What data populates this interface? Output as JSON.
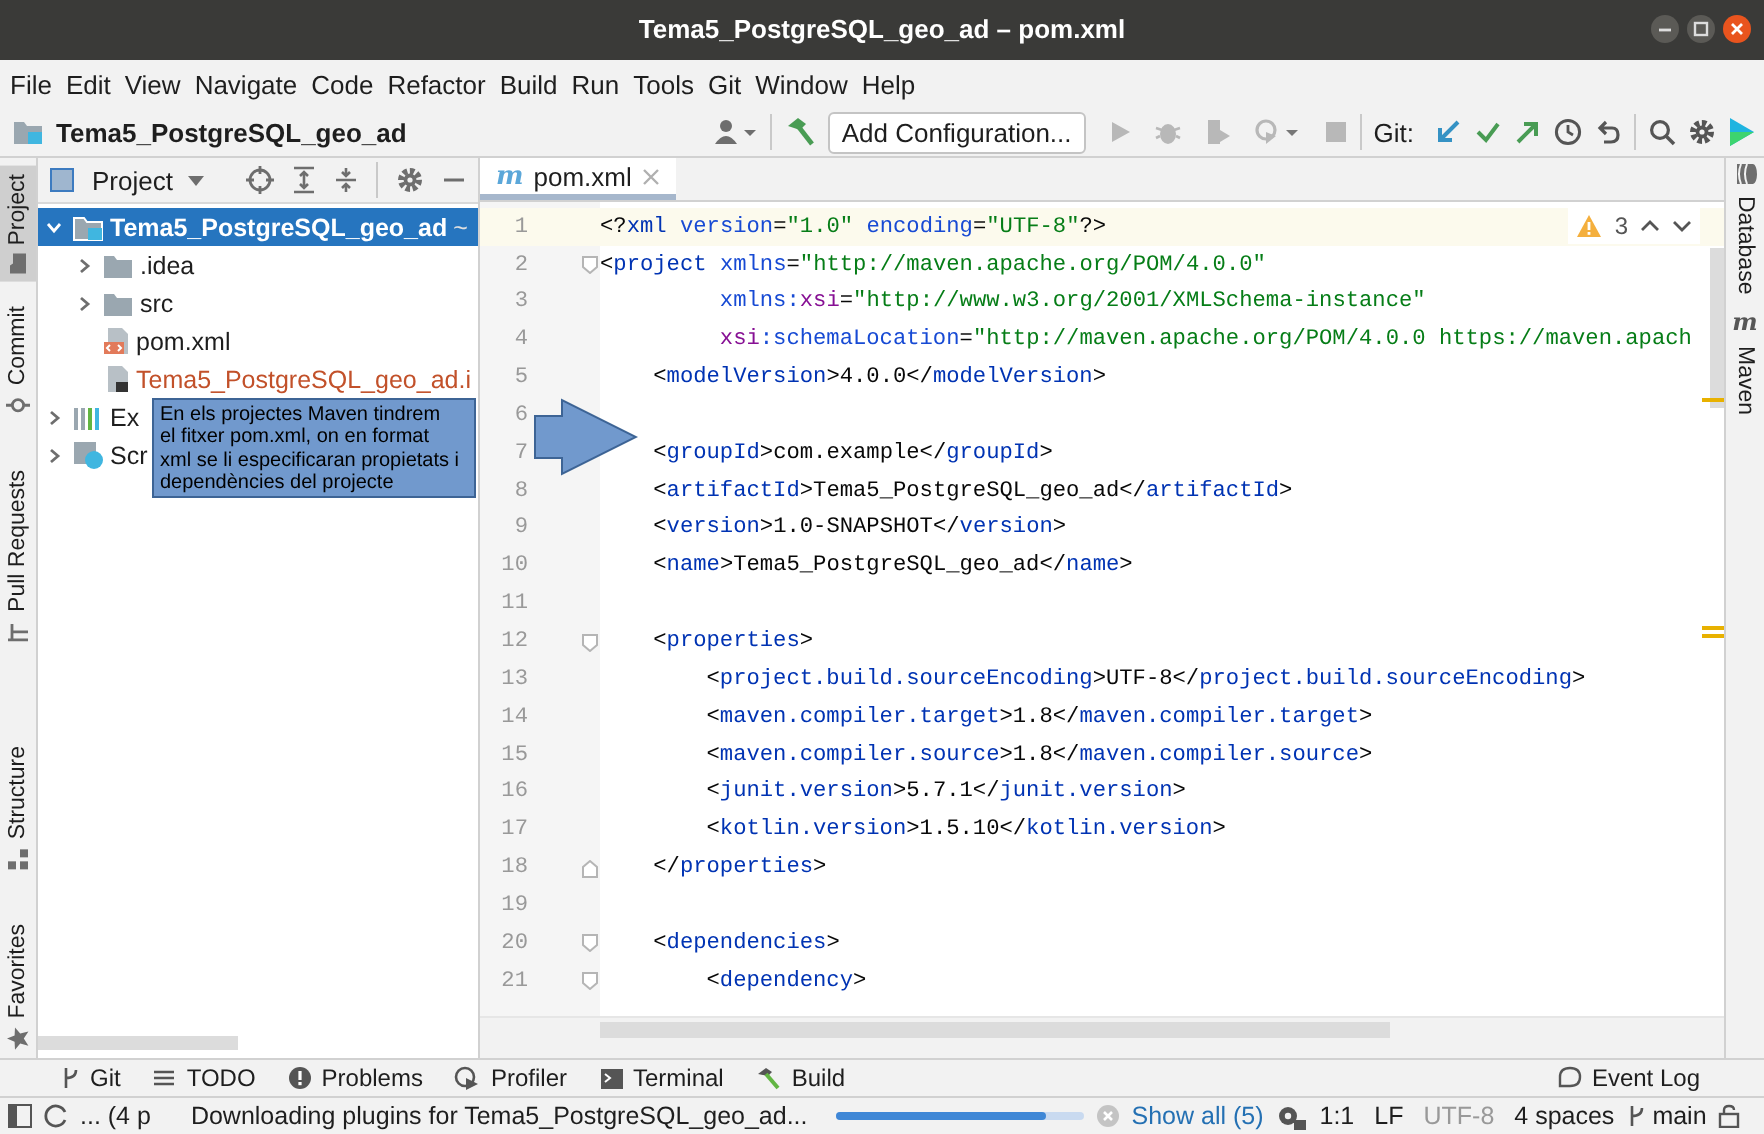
{
  "window": {
    "title": "Tema5_PostgreSQL_geo_ad – pom.xml"
  },
  "menu": [
    "File",
    "Edit",
    "View",
    "Navigate",
    "Code",
    "Refactor",
    "Build",
    "Run",
    "Tools",
    "Git",
    "Window",
    "Help"
  ],
  "toolbar": {
    "project": "Tema5_PostgreSQL_geo_ad",
    "run_config": "Add Configuration...",
    "run_tools": [
      {
        "kind": "run",
        "disabled": true
      },
      {
        "kind": "debug",
        "disabled": true
      },
      {
        "kind": "coverage",
        "disabled": true
      },
      {
        "kind": "profile",
        "disabled": true
      },
      {
        "kind": "stop",
        "disabled": true
      }
    ],
    "git_label": "Git:"
  },
  "left_stripe": [
    {
      "label": "Project",
      "kind": "project",
      "selected": true
    },
    {
      "label": "Commit",
      "kind": "commit",
      "selected": false
    },
    {
      "label": "Pull Requests",
      "kind": "pull",
      "selected": false
    },
    {
      "label": "Structure",
      "kind": "structure",
      "selected": false
    },
    {
      "label": "Favorites",
      "kind": "favorites",
      "selected": false
    }
  ],
  "project_panel": {
    "title": "Project",
    "tree": [
      {
        "label": "Tema5_PostgreSQL_geo_ad",
        "path": "~",
        "kind": "module",
        "expanded": true,
        "selected": true,
        "children": [
          {
            "label": ".idea",
            "kind": "folder",
            "expanded": false,
            "selected": false
          },
          {
            "label": "src",
            "kind": "folder",
            "expanded": false,
            "selected": false
          },
          {
            "label": "pom.xml",
            "kind": "xml",
            "selected": false
          },
          {
            "label": "Tema5_PostgreSQL_geo_ad.i",
            "kind": "iml",
            "unversioned": true,
            "selected": false
          }
        ]
      },
      {
        "label": "Ex",
        "kind": "library",
        "expanded": false,
        "selected": false
      },
      {
        "label": "Scr",
        "kind": "scratch",
        "expanded": false,
        "selected": false
      }
    ]
  },
  "editor": {
    "tabs": [
      {
        "label": "pom.xml",
        "icon_text": "m",
        "selected": true
      }
    ],
    "warnings": "3",
    "lines": [
      {
        "number": "1",
        "current": true,
        "tokens": [
          {
            "kind": "punct",
            "text": "<?"
          },
          {
            "kind": "tag",
            "text": "xml"
          },
          {
            "kind": "attr",
            "text": " version"
          },
          {
            "kind": "punct",
            "text": "="
          },
          {
            "kind": "string",
            "text": "\"1.0\""
          },
          {
            "kind": "attr",
            "text": " encoding"
          },
          {
            "kind": "punct",
            "text": "="
          },
          {
            "kind": "string",
            "text": "\"UTF-8\""
          },
          {
            "kind": "punct",
            "text": "?>"
          }
        ]
      },
      {
        "number": "2",
        "current": false,
        "foldable": true,
        "tokens": [
          {
            "kind": "punct",
            "text": "<"
          },
          {
            "kind": "tag",
            "text": "project"
          },
          {
            "kind": "attr",
            "text": " xmlns"
          },
          {
            "kind": "punct",
            "text": "="
          },
          {
            "kind": "string",
            "text": "\"http://maven.apache.org/POM/4.0.0\""
          }
        ]
      },
      {
        "number": "3",
        "current": false,
        "tokens": [
          {
            "kind": "attr",
            "text": "         xmlns:"
          },
          {
            "kind": "ns",
            "text": "xsi"
          },
          {
            "kind": "punct",
            "text": "="
          },
          {
            "kind": "string",
            "text": "\"http://www.w3.org/2001/XMLSchema-instance\""
          }
        ]
      },
      {
        "number": "4",
        "current": false,
        "tokens": [
          {
            "kind": "ns",
            "text": "         xsi"
          },
          {
            "kind": "attr",
            "text": ":schemaLocation"
          },
          {
            "kind": "punct",
            "text": "="
          },
          {
            "kind": "string",
            "text": "\"http://maven.apache.org/POM/4.0.0 https://maven.apach"
          }
        ]
      },
      {
        "number": "5",
        "current": false,
        "tokens": [
          {
            "kind": "punct",
            "text": "    <"
          },
          {
            "kind": "tag",
            "text": "modelVersion"
          },
          {
            "kind": "text",
            "text": ">4.0.0</"
          },
          {
            "kind": "tag",
            "text": "modelVersion"
          },
          {
            "kind": "punct",
            "text": ">"
          }
        ]
      },
      {
        "number": "6",
        "current": false
      },
      {
        "number": "7",
        "current": false,
        "tokens": [
          {
            "kind": "punct",
            "text": "    <"
          },
          {
            "kind": "tag",
            "text": "groupId"
          },
          {
            "kind": "text",
            "text": ">com.example</"
          },
          {
            "kind": "tag",
            "text": "groupId"
          },
          {
            "kind": "punct",
            "text": ">"
          }
        ]
      },
      {
        "number": "8",
        "current": false,
        "tokens": [
          {
            "kind": "punct",
            "text": "    <"
          },
          {
            "kind": "tag",
            "text": "artifactId"
          },
          {
            "kind": "text",
            "text": ">Tema5_PostgreSQL_geo_ad</"
          },
          {
            "kind": "tag",
            "text": "artifactId"
          },
          {
            "kind": "punct",
            "text": ">"
          }
        ]
      },
      {
        "number": "9",
        "current": false,
        "tokens": [
          {
            "kind": "punct",
            "text": "    <"
          },
          {
            "kind": "tag",
            "text": "version"
          },
          {
            "kind": "text",
            "text": ">1.0-SNAPSHOT</"
          },
          {
            "kind": "tag",
            "text": "version"
          },
          {
            "kind": "punct",
            "text": ">"
          }
        ]
      },
      {
        "number": "10",
        "current": false,
        "tokens": [
          {
            "kind": "punct",
            "text": "    <"
          },
          {
            "kind": "tag",
            "text": "name"
          },
          {
            "kind": "text",
            "text": ">Tema5_PostgreSQL_geo_ad</"
          },
          {
            "kind": "tag",
            "text": "name"
          },
          {
            "kind": "punct",
            "text": ">"
          }
        ]
      },
      {
        "number": "11",
        "current": false
      },
      {
        "number": "12",
        "current": false,
        "foldable": true,
        "tokens": [
          {
            "kind": "punct",
            "text": "    <"
          },
          {
            "kind": "tag",
            "text": "properties"
          },
          {
            "kind": "punct",
            "text": ">"
          }
        ]
      },
      {
        "number": "13",
        "current": false,
        "tokens": [
          {
            "kind": "punct",
            "text": "        <"
          },
          {
            "kind": "tag",
            "text": "project.build.sourceEncoding"
          },
          {
            "kind": "text",
            "text": ">UTF-8</"
          },
          {
            "kind": "tag",
            "text": "project.build.sourceEncoding"
          },
          {
            "kind": "punct",
            "text": ">"
          }
        ]
      },
      {
        "number": "14",
        "current": false,
        "tokens": [
          {
            "kind": "punct",
            "text": "        <"
          },
          {
            "kind": "tag",
            "text": "maven.compiler.target"
          },
          {
            "kind": "text",
            "text": ">1.8</"
          },
          {
            "kind": "tag",
            "text": "maven.compiler.target"
          },
          {
            "kind": "punct",
            "text": ">"
          }
        ]
      },
      {
        "number": "15",
        "current": false,
        "tokens": [
          {
            "kind": "punct",
            "text": "        <"
          },
          {
            "kind": "tag",
            "text": "maven.compiler.source"
          },
          {
            "kind": "text",
            "text": ">1.8</"
          },
          {
            "kind": "tag",
            "text": "maven.compiler.source"
          },
          {
            "kind": "punct",
            "text": ">"
          }
        ]
      },
      {
        "number": "16",
        "current": false,
        "tokens": [
          {
            "kind": "punct",
            "text": "        <"
          },
          {
            "kind": "tag",
            "text": "junit.version"
          },
          {
            "kind": "text",
            "text": ">5.7.1</"
          },
          {
            "kind": "tag",
            "text": "junit.version"
          },
          {
            "kind": "punct",
            "text": ">"
          }
        ]
      },
      {
        "number": "17",
        "current": false,
        "tokens": [
          {
            "kind": "punct",
            "text": "        <"
          },
          {
            "kind": "tag",
            "text": "kotlin.version"
          },
          {
            "kind": "text",
            "text": ">1.5.10</"
          },
          {
            "kind": "tag",
            "text": "kotlin.version"
          },
          {
            "kind": "punct",
            "text": ">"
          }
        ]
      },
      {
        "number": "18",
        "current": false,
        "fold_end": true,
        "tokens": [
          {
            "kind": "punct",
            "text": "    </"
          },
          {
            "kind": "tag",
            "text": "properties"
          },
          {
            "kind": "punct",
            "text": ">"
          }
        ]
      },
      {
        "number": "19",
        "current": false
      },
      {
        "number": "20",
        "current": false,
        "foldable": true,
        "tokens": [
          {
            "kind": "punct",
            "text": "    <"
          },
          {
            "kind": "tag",
            "text": "dependencies"
          },
          {
            "kind": "punct",
            "text": ">"
          }
        ]
      },
      {
        "number": "21",
        "current": false,
        "foldable": true,
        "tokens": [
          {
            "kind": "punct",
            "text": "        <"
          },
          {
            "kind": "tag",
            "text": "dependency"
          },
          {
            "kind": "punct",
            "text": ">"
          }
        ]
      }
    ]
  },
  "right_stripe": [
    {
      "label": "Database",
      "kind": "database"
    },
    {
      "label": "Maven",
      "kind": "maven",
      "icon_text": "m"
    }
  ],
  "bottom_tools": [
    {
      "label": "Git",
      "kind": "git"
    },
    {
      "label": "TODO",
      "kind": "todo"
    },
    {
      "label": "Problems",
      "kind": "problems"
    },
    {
      "label": "Profiler",
      "kind": "profiler"
    },
    {
      "label": "Terminal",
      "kind": "terminal"
    },
    {
      "label": "Build",
      "kind": "build"
    }
  ],
  "event_log": "Event Log",
  "status_bar": {
    "processes": "... (4 p",
    "task": "Downloading plugins for Tema5_PostgreSQL_geo_ad...",
    "level": 0.85,
    "show_all": "Show all (5)",
    "position": "1:1",
    "line_separator": "LF",
    "encoding": "UTF-8",
    "indent": "4 spaces",
    "branch": "main"
  },
  "callout": {
    "lines": [
      "En els projectes Maven tindrem",
      "el fitxer pom.xml, on en format",
      "xml se li especificaran propietats i",
      "dependències del projecte"
    ]
  }
}
